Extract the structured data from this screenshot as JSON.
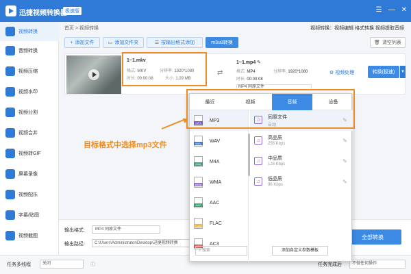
{
  "app": {
    "title": "迅捷视频转换器",
    "badge": "极速版"
  },
  "colors": {
    "primary": "#2f7ad6",
    "highlight": "#f08c22"
  },
  "sidebar": {
    "items": [
      {
        "label": "视频转换",
        "icon": "video-convert-icon",
        "active": true
      },
      {
        "label": "音频转换",
        "icon": "audio-convert-icon"
      },
      {
        "label": "视频压缩",
        "icon": "compress-icon"
      },
      {
        "label": "视频水印",
        "icon": "watermark-icon"
      },
      {
        "label": "视频分割",
        "icon": "split-icon"
      },
      {
        "label": "视频合并",
        "icon": "merge-icon"
      },
      {
        "label": "视频转GIF",
        "icon": "gif-icon"
      },
      {
        "label": "屏幕录像",
        "icon": "record-icon"
      },
      {
        "label": "视频配乐",
        "icon": "music-icon"
      },
      {
        "label": "字幕/贴图",
        "icon": "subtitle-icon"
      },
      {
        "label": "视频截图",
        "icon": "screenshot-icon"
      }
    ]
  },
  "breadcrumb": "首页 > 视频转换",
  "toplinks": "视频转换：视频编辑 格式转换 视频提取音频",
  "toolbar": {
    "add_file": "添加文件",
    "add_folder": "添加文件夹",
    "add_by_format": "按输出格式添加",
    "m3u8": "m3u8转换",
    "clear": "清空列表"
  },
  "file": {
    "name": "1~1.mkv",
    "format_label": "格式:",
    "format": "MKV",
    "res_label": "分辨率:",
    "res": "1920*1080",
    "dur_label": "时长:",
    "dur": "00:00:08",
    "size_label": "大小:",
    "size": "1.29 MB"
  },
  "output_file": {
    "name": "1~1.mp4",
    "format_label": "格式:",
    "format": "MP4",
    "res_label": "分辨率:",
    "res": "1920*1080",
    "dur_label": "时长:",
    "dur": "00:00:08",
    "select": "MP4  同原文件",
    "process": "视频处理",
    "convert": "转换(极速)"
  },
  "popup": {
    "tabs": [
      "最近",
      "视频",
      "音频",
      "设备"
    ],
    "formats": [
      {
        "name": "MP3",
        "tag": "MP3",
        "color": "#7a4fcf"
      },
      {
        "name": "WAV",
        "tag": "WAV",
        "color": "#2f7ad6"
      },
      {
        "name": "M4A",
        "tag": "M4A",
        "color": "#2aa66a"
      },
      {
        "name": "WMA",
        "tag": "WMA",
        "color": "#8e6ad4"
      },
      {
        "name": "AAC",
        "tag": "AAC",
        "color": "#2aa66a"
      },
      {
        "name": "FLAC",
        "tag": "FLAC",
        "color": "#f0b429"
      },
      {
        "name": "AC3",
        "tag": "AC3",
        "color": "#e0524a"
      }
    ],
    "qualities": [
      {
        "name": "同原文件",
        "sub": "自动"
      },
      {
        "name": "高品质",
        "sub": "256 Kbps"
      },
      {
        "name": "中品质",
        "sub": "128 Kbps"
      },
      {
        "name": "低品质",
        "sub": "96 Kbps"
      }
    ],
    "search_placeholder": "搜索",
    "custom": "添加自定义参数模板"
  },
  "annotation": "目标格式中选择mp3文件",
  "bottom": {
    "out_format_label": "输出格式:",
    "out_format": "MP4  同原文件",
    "out_path_label": "输出路径:",
    "out_path": "C:\\Users\\Administrator\\Desktop\\迅捷视频转换",
    "all_convert": "全部转换"
  },
  "statusbar": {
    "threads_label": "任务多线程",
    "threads": "关闭",
    "after_label": "任务完成后",
    "after": "不做任何操作"
  }
}
